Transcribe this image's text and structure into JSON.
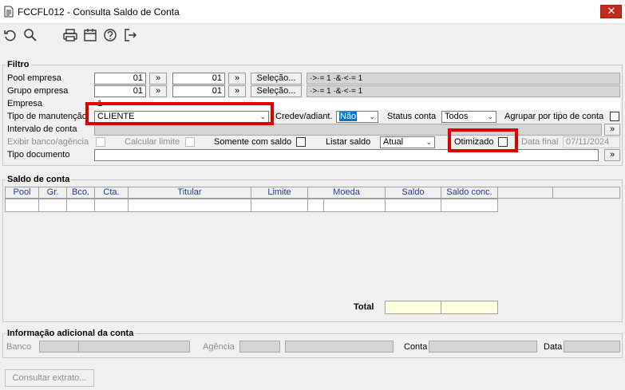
{
  "window": {
    "title": "FCCFL012 - Consulta Saldo de Conta",
    "close_glyph": "✕"
  },
  "toolbar": {
    "icons": [
      "refresh-icon",
      "search-icon",
      "print-icon",
      "calendar-icon",
      "help-icon",
      "exit-icon"
    ]
  },
  "filtro": {
    "title": "Filtro",
    "pool_label": "Pool empresa",
    "pool_from": "01",
    "pool_to": "01",
    "pool_range": "·>·= 1 ·&·<·= 1",
    "grupo_label": "Grupo empresa",
    "grupo_from": "01",
    "grupo_to": "01",
    "grupo_range": "·>·= 1 ·&·<·= 1",
    "arrow": "»",
    "selecao_label": "Seleção...",
    "empresa_label": "Empresa",
    "empresa_value": "1",
    "tipo_manut_label": "Tipo de manutenção",
    "tipo_manut_value": "CLIENTE",
    "credev_label": "Credev/adiant.",
    "credev_value": "Não",
    "status_label": "Status conta",
    "status_value": "Todos",
    "agrupar_label": "Agrupar por tipo de conta",
    "intervalo_label": "Intervalo de conta",
    "exibir_label": "Exibir banco/agência",
    "calcular_label": "Calcular limite",
    "somente_label": "Somente com saldo",
    "listar_label": "Listar saldo",
    "listar_value": "Atual",
    "otimizado_label": "Otimizado",
    "data_final_label": "Data final",
    "data_final_value": "07/11/2024",
    "tipo_doc_label": "Tipo documento"
  },
  "saldo": {
    "title": "Saldo de conta",
    "columns": [
      "Pool",
      "Gr.",
      "Bco.",
      "Cta.",
      "Titular",
      "Limite",
      "Moeda",
      "Saldo",
      "Saldo conc.",
      "",
      ""
    ],
    "total_label": "Total"
  },
  "info": {
    "title": "Informação adicional da conta",
    "banco_label": "Banco",
    "agencia_label": "Agência",
    "conta_label": "Conta",
    "data_label": "Data"
  },
  "footer": {
    "consultar_label": "Consultar extrato..."
  }
}
